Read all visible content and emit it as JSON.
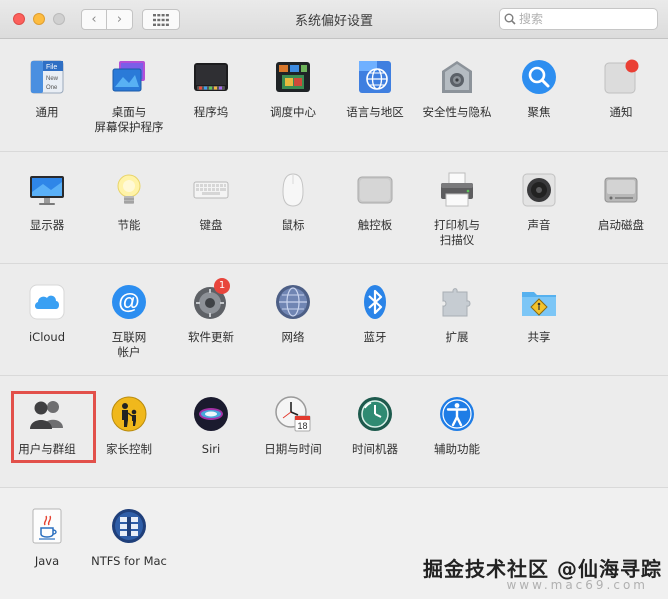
{
  "window": {
    "title": "系统偏好设置",
    "search_placeholder": "搜索",
    "back_label": "‹",
    "forward_label": "›"
  },
  "rows": [
    [
      {
        "name": "pane-general",
        "label": "通用",
        "icon": "general-icon"
      },
      {
        "name": "pane-desktop-screensaver",
        "label": "桌面与\n屏幕保护程序",
        "icon": "desktop-screensaver-icon"
      },
      {
        "name": "pane-dock",
        "label": "程序坞",
        "icon": "dock-icon"
      },
      {
        "name": "pane-mission-control",
        "label": "调度中心",
        "icon": "mission-control-icon"
      },
      {
        "name": "pane-language-region",
        "label": "语言与地区",
        "icon": "language-region-icon"
      },
      {
        "name": "pane-security-privacy",
        "label": "安全性与隐私",
        "icon": "security-icon"
      },
      {
        "name": "pane-spotlight",
        "label": "聚焦",
        "icon": "spotlight-icon"
      },
      {
        "name": "pane-notifications",
        "label": "通知",
        "icon": "notifications-icon"
      }
    ],
    [
      {
        "name": "pane-displays",
        "label": "显示器",
        "icon": "display-icon"
      },
      {
        "name": "pane-energy-saver",
        "label": "节能",
        "icon": "lightbulb-icon"
      },
      {
        "name": "pane-keyboard",
        "label": "键盘",
        "icon": "keyboard-icon"
      },
      {
        "name": "pane-mouse",
        "label": "鼠标",
        "icon": "mouse-icon"
      },
      {
        "name": "pane-trackpad",
        "label": "触控板",
        "icon": "trackpad-icon"
      },
      {
        "name": "pane-printers-scanners",
        "label": "打印机与\n扫描仪",
        "icon": "printer-icon"
      },
      {
        "name": "pane-sound",
        "label": "声音",
        "icon": "speaker-icon"
      },
      {
        "name": "pane-startup-disk",
        "label": "启动磁盘",
        "icon": "disk-icon"
      }
    ],
    [
      {
        "name": "pane-icloud",
        "label": "iCloud",
        "icon": "icloud-icon"
      },
      {
        "name": "pane-internet-accounts",
        "label": "互联网\n帐户",
        "icon": "at-icon"
      },
      {
        "name": "pane-software-update",
        "label": "软件更新",
        "icon": "software-update-icon",
        "badge": "1"
      },
      {
        "name": "pane-network",
        "label": "网络",
        "icon": "network-globe-icon"
      },
      {
        "name": "pane-bluetooth",
        "label": "蓝牙",
        "icon": "bluetooth-icon"
      },
      {
        "name": "pane-extensions",
        "label": "扩展",
        "icon": "puzzle-icon"
      },
      {
        "name": "pane-sharing",
        "label": "共享",
        "icon": "sharing-folder-icon"
      }
    ],
    [
      {
        "name": "pane-users-groups",
        "label": "用户与群组",
        "icon": "users-icon"
      },
      {
        "name": "pane-parental-controls",
        "label": "家长控制",
        "icon": "parental-controls-icon"
      },
      {
        "name": "pane-siri",
        "label": "Siri",
        "icon": "siri-icon"
      },
      {
        "name": "pane-date-time",
        "label": "日期与时间",
        "icon": "clock-calendar-icon",
        "calendar_day": "18"
      },
      {
        "name": "pane-time-machine",
        "label": "时间机器",
        "icon": "time-machine-icon"
      },
      {
        "name": "pane-accessibility",
        "label": "辅助功能",
        "icon": "accessibility-icon"
      }
    ],
    [
      {
        "name": "pane-java",
        "label": "Java",
        "icon": "java-icon"
      },
      {
        "name": "pane-ntfs-for-mac",
        "label": "NTFS for Mac",
        "icon": "ntfs-icon"
      }
    ]
  ],
  "general_icon_text": [
    "File",
    "New",
    "One"
  ],
  "watermark": "掘金技术社区 @仙海寻踪",
  "watermark_sub": "www.mac69.com",
  "colors": {
    "highlight": "#e2504a",
    "badge": "#e8453c",
    "blue": "#1f7de6"
  }
}
